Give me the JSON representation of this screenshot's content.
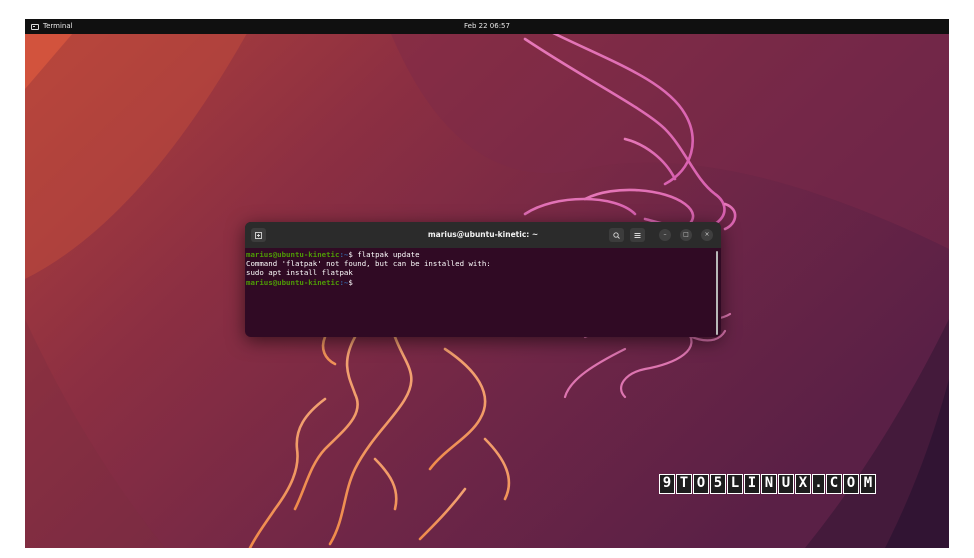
{
  "topbar": {
    "app_name": "Terminal",
    "clock": "Feb 22  06:57"
  },
  "terminal": {
    "title": "marius@ubuntu-kinetic: ~",
    "lines": [
      {
        "user": "marius@ubuntu-kinetic",
        "dir": ":~",
        "prompt": "$ ",
        "command": "flatpak update"
      },
      {
        "text": "Command 'flatpak' not found, but can be installed with:"
      },
      {
        "text": "sudo apt install flatpak"
      },
      {
        "user": "marius@ubuntu-kinetic",
        "dir": ":~",
        "prompt": "$ ",
        "command": ""
      }
    ],
    "buttons": {
      "new_tab_icon": "new-tab-icon",
      "search_icon": "search-icon",
      "menu_icon": "hamburger-menu-icon",
      "minimize": "–",
      "maximize": "□",
      "close": "×"
    }
  },
  "watermark": {
    "chars": [
      "9",
      "T",
      "O",
      "5",
      "L",
      "I",
      "N",
      "U",
      "X",
      ".",
      "C",
      "O",
      "M"
    ]
  },
  "colors": {
    "terminal_bg": "#300a24",
    "prompt_user": "#4e9a06",
    "prompt_dir": "#3465a4",
    "wallpaper_base": "#6a2742"
  }
}
